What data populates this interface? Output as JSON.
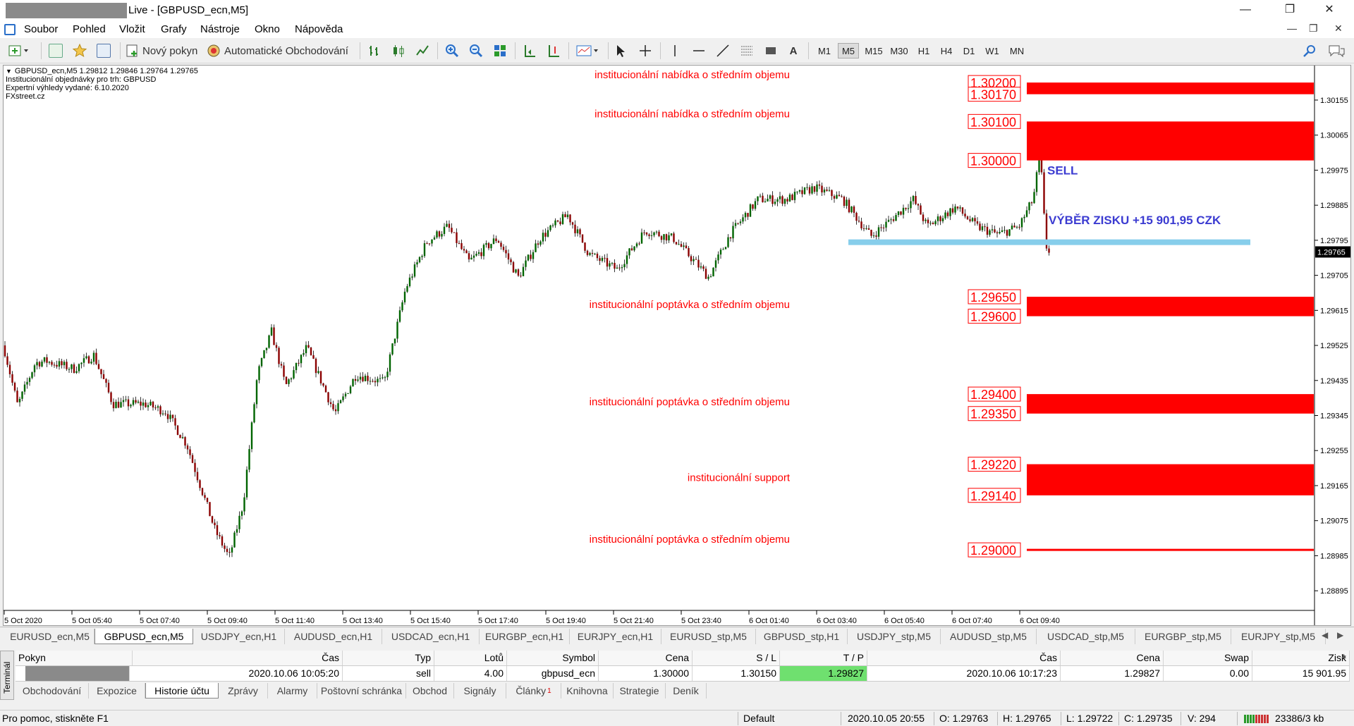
{
  "window": {
    "title": "Live - [GBPUSD_ecn,M5]",
    "minimize": "—",
    "maximize": "❐",
    "close": "✕"
  },
  "menu": [
    "Soubor",
    "Pohled",
    "Vložit",
    "Grafy",
    "Nástroje",
    "Okno",
    "Nápověda"
  ],
  "toolbar": {
    "new_order": "Nový pokyn",
    "auto_trading": "Automatické Obchodování",
    "timeframes": [
      "M1",
      "M5",
      "M15",
      "M30",
      "H1",
      "H4",
      "D1",
      "W1",
      "MN"
    ],
    "active_timeframe": "M5",
    "text_tool": "A"
  },
  "chart_info": [
    "GBPUSD_ecn,M5  1.29812 1.29846 1.29764 1.29765",
    "Institucionální objednávky pro trh: GBPUSD",
    "Expertní výhledy vydané: 6.10.2020",
    "FXstreet.cz"
  ],
  "chart_data": {
    "type": "candlestick",
    "symbol": "GBPUSD_ecn",
    "timeframe": "M5",
    "ohlc_last": {
      "open": 1.29812,
      "high": 1.29846,
      "low": 1.29764,
      "close": 1.29765
    },
    "current_price": "1.29765",
    "y_ticks": [
      "1.30155",
      "1.30065",
      "1.29975",
      "1.29885",
      "1.29795",
      "1.29705",
      "1.29615",
      "1.29525",
      "1.29435",
      "1.29345",
      "1.29255",
      "1.29165",
      "1.29075",
      "1.28985",
      "1.28895"
    ],
    "ylim": [
      1.2885,
      1.3024
    ],
    "x_ticks": [
      "5 Oct 2020",
      "5 Oct 05:40",
      "5 Oct 07:40",
      "5 Oct 09:40",
      "5 Oct 11:40",
      "5 Oct 13:40",
      "5 Oct 15:40",
      "5 Oct 17:40",
      "5 Oct 19:40",
      "5 Oct 21:40",
      "5 Oct 23:40",
      "6 Oct 01:40",
      "6 Oct 03:40",
      "6 Oct 05:40",
      "6 Oct 07:40",
      "6 Oct 09:40"
    ],
    "price_path": [
      [
        0,
        1.29525
      ],
      [
        20,
        1.2937
      ],
      [
        45,
        1.2948
      ],
      [
        60,
        1.29485
      ],
      [
        100,
        1.29465
      ],
      [
        128,
        1.295
      ],
      [
        155,
        1.29375
      ],
      [
        200,
        1.29375
      ],
      [
        230,
        1.29355
      ],
      [
        260,
        1.2927
      ],
      [
        300,
        1.2905
      ],
      [
        320,
        1.2898
      ],
      [
        340,
        1.2912
      ],
      [
        360,
        1.2945
      ],
      [
        380,
        1.2956
      ],
      [
        400,
        1.2942
      ],
      [
        430,
        1.2952
      ],
      [
        470,
        1.2935
      ],
      [
        500,
        1.2945
      ],
      [
        540,
        1.2943
      ],
      [
        570,
        1.2967
      ],
      [
        600,
        1.2979
      ],
      [
        630,
        1.2983
      ],
      [
        660,
        1.2974
      ],
      [
        700,
        1.298
      ],
      [
        730,
        1.297
      ],
      [
        760,
        1.298
      ],
      [
        800,
        1.2986
      ],
      [
        830,
        1.2976
      ],
      [
        870,
        1.2972
      ],
      [
        910,
        1.2982
      ],
      [
        950,
        1.298
      ],
      [
        980,
        1.2974
      ],
      [
        1000,
        1.297
      ],
      [
        1030,
        1.2981
      ],
      [
        1070,
        1.299
      ],
      [
        1110,
        1.299
      ],
      [
        1150,
        1.2993
      ],
      [
        1190,
        1.299
      ],
      [
        1230,
        1.29805
      ],
      [
        1260,
        1.2985
      ],
      [
        1290,
        1.299
      ],
      [
        1310,
        1.2983
      ],
      [
        1350,
        1.2988
      ],
      [
        1380,
        1.2983
      ],
      [
        1410,
        1.2981
      ],
      [
        1440,
        1.2983
      ],
      [
        1460,
        1.299
      ],
      [
        1470,
        1.3002
      ],
      [
        1478,
        1.2978
      ],
      [
        1484,
        1.29765
      ]
    ],
    "zones": [
      {
        "label": "institucionální nabídka o středním objemu",
        "top": 1.302,
        "bottom": 1.3017,
        "top_label": "1.30200",
        "bottom_label": "1.30170",
        "color": "#ff0000"
      },
      {
        "label": "institucionální nabídka o středním objemu",
        "top": 1.301,
        "bottom": 1.3,
        "top_label": "1.30100",
        "bottom_label": "1.30000",
        "color": "#ff0000"
      },
      {
        "label": "institucionální poptávka o středním objemu",
        "top": 1.2965,
        "bottom": 1.296,
        "top_label": "1.29650",
        "bottom_label": "1.29600",
        "color": "#ff0000"
      },
      {
        "label": "institucionální poptávka o středním objemu",
        "top": 1.294,
        "bottom": 1.2935,
        "top_label": "1.29400",
        "bottom_label": "1.29350",
        "color": "#ff0000"
      },
      {
        "label": "institucionální support",
        "top": 1.2922,
        "bottom": 1.2914,
        "top_label": "1.29220",
        "bottom_label": "1.29140",
        "color": "#ff0000"
      },
      {
        "label": "institucionální poptávka o středním objemu",
        "top": 1.29,
        "bottom": 1.29,
        "top_label": "1.29000",
        "bottom_label": "",
        "color": "#ff0000"
      }
    ],
    "annotations": [
      {
        "text": "SELL",
        "price": 1.29975,
        "color": "#3b3bd1"
      },
      {
        "text": "VÝBĚR ZISKU +15 901,95 CZK",
        "price": 1.29827,
        "color": "#3b3bd1"
      }
    ],
    "take_profit_line": {
      "price": 1.2979,
      "color": "#87ceeb"
    },
    "colors": {
      "bull": "#006400",
      "bear": "#8b0000",
      "wick": "#000000"
    }
  },
  "symbol_tabs": [
    "EURUSD_ecn,M5",
    "GBPUSD_ecn,M5",
    "USDJPY_ecn,H1",
    "AUDUSD_ecn,H1",
    "USDCAD_ecn,H1",
    "EURGBP_ecn,H1",
    "EURJPY_ecn,H1",
    "EURUSD_stp,M5",
    "GBPUSD_stp,H1",
    "USDJPY_stp,M5",
    "AUDUSD_stp,M5",
    "USDCAD_stp,M5",
    "EURGBP_stp,M5",
    "EURJPY_stp,M5"
  ],
  "active_symbol_tab": "GBPUSD_ecn,M5",
  "terminal": {
    "side_label": "Terminál",
    "headers": [
      "Pokyn",
      "Čas",
      "Typ",
      "Lotů",
      "Symbol",
      "Cena",
      "S / L",
      "T / P",
      "Čas",
      "Cena",
      "Swap",
      "Zisk"
    ],
    "row": [
      "",
      "2020.10.06 10:05:20",
      "sell",
      "4.00",
      "gbpusd_ecn",
      "1.30000",
      "1.30150",
      "1.29827",
      "2020.10.06 10:17:23",
      "1.29827",
      "0.00",
      "15 901.95"
    ],
    "tabs": [
      "Obchodování",
      "Expozice",
      "Historie účtu",
      "Zprávy",
      "Alarmy",
      "Poštovní schránka",
      "Obchod",
      "Signály",
      "Články",
      "Knihovna",
      "Strategie",
      "Deník"
    ],
    "active_tab": "Historie účtu",
    "articles_badge": "1"
  },
  "status": {
    "help": "Pro pomoc, stiskněte F1",
    "profile": "Default",
    "time": "2020.10.05 20:55",
    "open": "O: 1.29763",
    "high": "H: 1.29765",
    "low": "L: 1.29722",
    "close": "C: 1.29735",
    "volume": "V: 294",
    "traffic": "23386/3 kb"
  }
}
